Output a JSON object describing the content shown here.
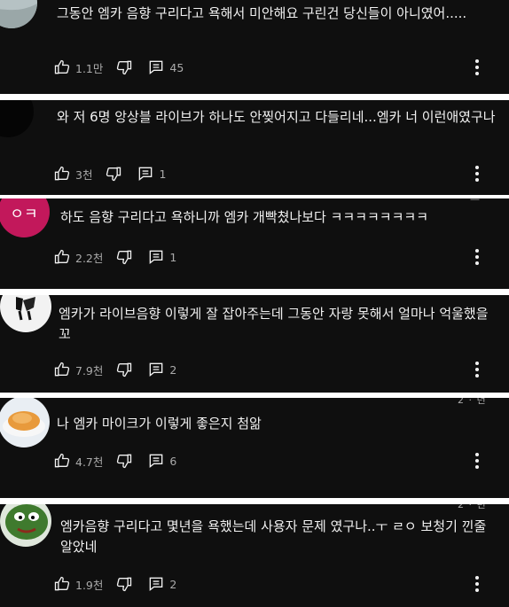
{
  "comments": [
    {
      "text": "그동안 엠카 음향 구리다고 욕해서 미안해요  구린건 당신들이 아니였어.....",
      "likes": "1.1만",
      "replies": "45",
      "avatar_color": "#b6c2c4"
    },
    {
      "text": "와 저 6명 앙상블 라이브가 하나도 안찢어지고 다들리네...엠카 너 이런애였구나",
      "likes": "3천",
      "replies": "1",
      "avatar_color": "#050505"
    },
    {
      "text": "하도 음향 구리다고 욕하니까 엠카 개빡쳤나보다 ㅋㅋㅋㅋㅋㅋㅋㅋ",
      "likes": "2.2천",
      "replies": "1",
      "avatar_color": "#c2185b",
      "avatar_text": "ㅇㅋ"
    },
    {
      "text": "엠카가 라이브음향 이렇게 잘 잡아주는데 그동안 자랑 못해서 얼마나 억울했을꼬",
      "likes": "7.9천",
      "replies": "2",
      "avatar_color": "#f2f2f2"
    },
    {
      "text": "나 엠카 마이크가 이렇게 좋은지 첨앎",
      "likes": "4.7천",
      "replies": "6",
      "avatar_color": "#e9eef3"
    },
    {
      "text": "엠카음향 구리다고 몇년을 욕했는데 사용자 문제 였구나..ㅜ ㄹㅇ 보청기 낀줄알았네",
      "likes": "1.9천",
      "replies": "2",
      "avatar_color": "#3f7a2e"
    }
  ],
  "icons": {
    "like": "thumb-up-icon",
    "dislike": "thumb-down-icon",
    "reply": "reply-icon",
    "more": "more-vert-icon"
  }
}
